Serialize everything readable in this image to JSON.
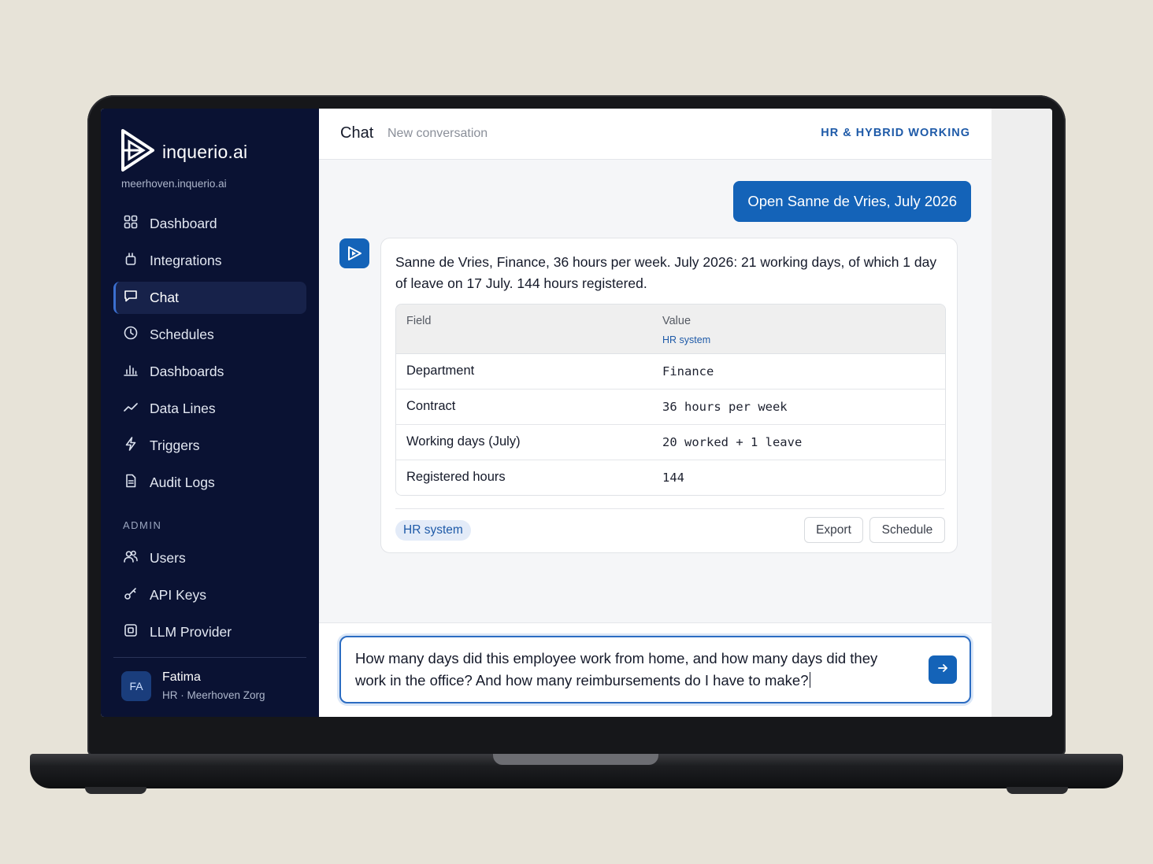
{
  "brand": {
    "name": "inquerio.ai",
    "domain": "meerhoven.inquerio.ai"
  },
  "sidebar": {
    "items": [
      {
        "label": "Dashboard",
        "icon": "grid-icon"
      },
      {
        "label": "Integrations",
        "icon": "plug-icon"
      },
      {
        "label": "Chat",
        "icon": "chat-icon",
        "active": true
      },
      {
        "label": "Schedules",
        "icon": "clock-icon"
      },
      {
        "label": "Dashboards",
        "icon": "bar-chart-icon"
      },
      {
        "label": "Data Lines",
        "icon": "trend-line-icon"
      },
      {
        "label": "Triggers",
        "icon": "lightning-icon"
      },
      {
        "label": "Audit Logs",
        "icon": "document-icon"
      }
    ],
    "admin_label": "ADMIN",
    "admin_items": [
      {
        "label": "Users",
        "icon": "users-icon"
      },
      {
        "label": "API Keys",
        "icon": "key-icon"
      },
      {
        "label": "LLM Provider",
        "icon": "chip-icon"
      }
    ],
    "user": {
      "initials": "FA",
      "name": "Fatima",
      "role": "HR · Meerhoven Zorg"
    }
  },
  "header": {
    "title": "Chat",
    "subtitle": "New conversation",
    "tag": "HR & HYBRID WORKING"
  },
  "conversation": {
    "user_message": "Open Sanne de Vries, July 2026",
    "answer": {
      "text": "Sanne de Vries, Finance, 36 hours per week. July 2026: 21 working days, of which 1 day of leave on 17 July. 144 hours registered.",
      "table": {
        "col_field": "Field",
        "col_value": "Value",
        "value_source": "HR system",
        "rows": [
          {
            "field": "Department",
            "value": "Finance"
          },
          {
            "field": "Contract",
            "value": "36 hours per week"
          },
          {
            "field": "Working days (July)",
            "value": "20 worked + 1 leave"
          },
          {
            "field": "Registered hours",
            "value": "144"
          }
        ]
      },
      "source_chip": "HR system",
      "export_label": "Export",
      "schedule_label": "Schedule"
    }
  },
  "composer": {
    "value": "How many days did this employee work from home, and how many days did they work in the office? And how many reimbursements do I have to make?"
  },
  "colors": {
    "sidebar": "#0a1233",
    "accent": "#1463b8",
    "background": "#e7e3d8"
  }
}
